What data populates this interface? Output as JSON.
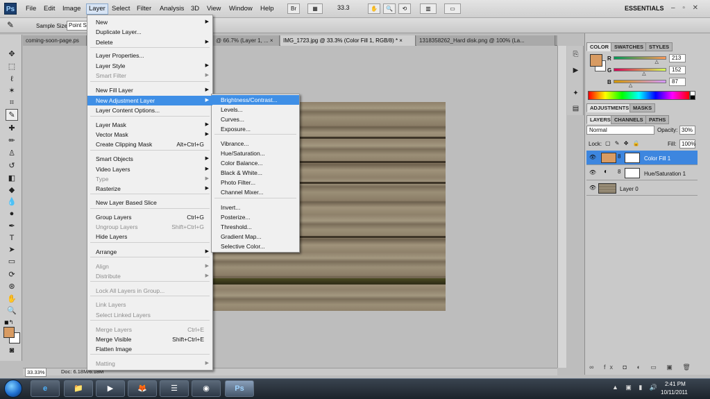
{
  "app": {
    "logo": "Ps",
    "accent": "#3f8fe6"
  },
  "menubar": {
    "items": [
      "File",
      "Edit",
      "Image",
      "Layer",
      "Select",
      "Filter",
      "Analysis",
      "3D",
      "View",
      "Window",
      "Help"
    ],
    "zoom": "33.3",
    "workspace": "ESSENTIALS",
    "window_controls": "– ▫ ✕"
  },
  "options": {
    "sample_size_label": "Sample Size:",
    "sample_size_value": "Point S"
  },
  "tabs": [
    {
      "label": "coming-soon-page.ps"
    },
    {
      "label": "@ 66.7% (Layer 1, ... ×"
    },
    {
      "label": "IMG_1723.jpg @ 33.3% (Color Fill 1, RGB/8) * ×"
    },
    {
      "label": "1318358262_Hard disk.png @ 100% (La..."
    }
  ],
  "layer_menu": {
    "items": [
      {
        "label": "New",
        "arrow": "▶"
      },
      {
        "label": "Duplicate Layer..."
      },
      {
        "label": "Delete",
        "arrow": "▶"
      },
      {
        "label": "Layer Properties..."
      },
      {
        "label": "Layer Style",
        "arrow": "▶"
      },
      {
        "label": "Smart Filter",
        "arrow": "▶",
        "disabled": true
      },
      {
        "label": "New Fill Layer",
        "arrow": "▶"
      },
      {
        "label": "New Adjustment Layer",
        "arrow": "▶",
        "highlight": true
      },
      {
        "label": "Layer Content Options..."
      },
      {
        "label": "Layer Mask",
        "arrow": "▶"
      },
      {
        "label": "Vector Mask",
        "arrow": "▶"
      },
      {
        "label": "Create Clipping Mask",
        "shortcut": "Alt+Ctrl+G"
      },
      {
        "label": "Smart Objects",
        "arrow": "▶"
      },
      {
        "label": "Video Layers",
        "arrow": "▶"
      },
      {
        "label": "Type",
        "arrow": "▶",
        "disabled": true
      },
      {
        "label": "Rasterize",
        "arrow": "▶"
      },
      {
        "label": "New Layer Based Slice"
      },
      {
        "label": "Group Layers",
        "shortcut": "Ctrl+G"
      },
      {
        "label": "Ungroup Layers",
        "shortcut": "Shift+Ctrl+G",
        "disabled": true
      },
      {
        "label": "Hide Layers"
      },
      {
        "label": "Arrange",
        "arrow": "▶"
      },
      {
        "label": "Align",
        "arrow": "▶",
        "disabled": true
      },
      {
        "label": "Distribute",
        "arrow": "▶",
        "disabled": true
      },
      {
        "label": "Lock All Layers in Group...",
        "disabled": true
      },
      {
        "label": "Link Layers",
        "disabled": true
      },
      {
        "label": "Select Linked Layers",
        "disabled": true
      },
      {
        "label": "Merge Layers",
        "shortcut": "Ctrl+E",
        "disabled": true
      },
      {
        "label": "Merge Visible",
        "shortcut": "Shift+Ctrl+E"
      },
      {
        "label": "Flatten Image"
      },
      {
        "label": "Matting",
        "arrow": "▶",
        "disabled": true
      }
    ]
  },
  "adjustment_submenu": {
    "items": [
      {
        "label": "Brightness/Contrast...",
        "highlight": true
      },
      {
        "label": "Levels..."
      },
      {
        "label": "Curves..."
      },
      {
        "label": "Exposure..."
      },
      {
        "label": "Vibrance..."
      },
      {
        "label": "Hue/Saturation..."
      },
      {
        "label": "Color Balance..."
      },
      {
        "label": "Black & White..."
      },
      {
        "label": "Photo Filter..."
      },
      {
        "label": "Channel Mixer..."
      },
      {
        "label": "Invert..."
      },
      {
        "label": "Posterize..."
      },
      {
        "label": "Threshold..."
      },
      {
        "label": "Gradient Map..."
      },
      {
        "label": "Selective Color..."
      }
    ]
  },
  "color_panel": {
    "tabs": [
      "COLOR",
      "SWATCHES",
      "STYLES"
    ],
    "fg_color": "#d89b62",
    "r_label": "R",
    "g_label": "G",
    "b_label": "B",
    "r": "213",
    "g": "152",
    "b": "87",
    "r_level": 0.835,
    "g_level": 0.596,
    "b_level": 0.341
  },
  "adjustments_panel": {
    "tabs": [
      "ADJUSTMENTS",
      "MASKS"
    ]
  },
  "layers_panel": {
    "tabs": [
      "LAYERS",
      "CHANNELS",
      "PATHS"
    ],
    "blend_mode": "Normal",
    "opacity_label": "Opacity:",
    "opacity": "30%",
    "lock_label": "Lock:",
    "fill_label": "Fill:",
    "fill": "100%",
    "layers": [
      {
        "name": "Color Fill 1",
        "selected": true,
        "thumb_color": "#d89b62"
      },
      {
        "name": "Hue/Saturation 1",
        "selected": false
      },
      {
        "name": "Layer 0",
        "selected": false
      }
    ],
    "footer_icons": "∞ fx ◘ ◐ ▭ ▣ 🗑"
  },
  "status": {
    "zoom": "33.33%",
    "doc": "Doc: 6.18M/6.18M"
  },
  "taskbar": {
    "time": "2:41 PM",
    "date": "10/11/2011",
    "active_app": "Ps"
  }
}
